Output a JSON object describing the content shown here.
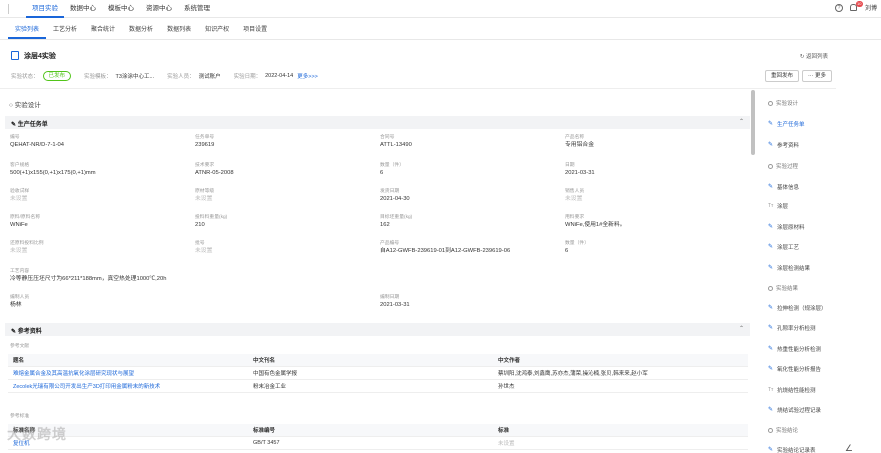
{
  "topnav": {
    "items": [
      "项目实验",
      "数据中心",
      "模板中心",
      "资源中心",
      "系统管理"
    ],
    "active_index": 0,
    "help_glyph": "?",
    "notification_count": "10",
    "user_name": "刘博"
  },
  "subtabs": {
    "items": [
      "实验列表",
      "工艺分析",
      "聚合统计",
      "数据分析",
      "数据列表",
      "知识产权",
      "项目设置"
    ],
    "active_index": 0
  },
  "header": {
    "title": "涂层4实验",
    "back_label": "返回列表",
    "status_label": "实验状态：",
    "status_value": "已发布",
    "template_label": "实验模板：",
    "template_value": "T3涂涂中心工...",
    "person_label": "实验人员：",
    "person_value": "测试账户",
    "date_label": "实验日期：",
    "date_value": "2022-04-14",
    "more_label": "更多>>>",
    "republish_label": "重回发布",
    "more_btn_label": "··· 更多"
  },
  "main": {
    "design_label": "实验设计",
    "task_section": "生产任务单",
    "fields": [
      {
        "k": "编号",
        "v": "QEHAT-NR/D-7-1-04"
      },
      {
        "k": "任务单号",
        "v": "239619"
      },
      {
        "k": "合同号",
        "v": "ATTL-13490"
      },
      {
        "k": "产品名称",
        "v": "专用铝合金"
      },
      {
        "k": "客户规格",
        "v": "500(+1)x155(0,+1)x175(0,+1)mm"
      },
      {
        "k": "技术要求",
        "v": "ATNR-05-2008"
      },
      {
        "k": "数量（件）",
        "v": "6"
      },
      {
        "k": "日期",
        "v": "2021-03-31"
      },
      {
        "k": "验收试样",
        "v": "未设置"
      },
      {
        "k": "原材等级",
        "v": "未设置"
      },
      {
        "k": "发货日期",
        "v": "2021-04-30"
      },
      {
        "k": "销售人员",
        "v": "未设置"
      },
      {
        "k": "原料/原料名称",
        "v": "WNiFe"
      },
      {
        "k": "投料料重量(kg)",
        "v": "210"
      },
      {
        "k": "目标坯重量(kg)",
        "v": "162"
      },
      {
        "k": "用料要求",
        "v": "WNiFe,使用1#全新料。"
      },
      {
        "k": "还原料投料比例",
        "v": "未设置"
      },
      {
        "k": "批号",
        "v": "未设置"
      },
      {
        "k": "产品编号",
        "v": "自A12-GWFB-239619-01到A12-GWFB-239619-06"
      },
      {
        "k": "数量（件）",
        "v": "6"
      },
      {
        "k": "工艺内容",
        "v": "冷等静压压坯尺寸为66*211*188mm，真空热处理1000℃,20h"
      },
      {
        "k": "编制人员",
        "v": "杨林"
      },
      {
        "k": "编制日期",
        "v": "2021-03-31"
      }
    ],
    "ref_section": "参考资料",
    "lit_label": "参考文献",
    "lit_headers": [
      "题名",
      "中文刊名",
      "中文作者"
    ],
    "lit_rows": [
      [
        "难熔金属合金及其高温抗氧化涂层研究现状与展望",
        "中国有色金属学报",
        "蔡圳阳,沈鸿泰,刘鑫鹰,苏亦杰,蒲荣,操沁楠,张贝,韩来来,赵小军"
      ],
      [
        "Zecolek光瑞有限公司开发出生产3D打印用金属粉末的新技术",
        "粉末冶金工业",
        "孙世杰"
      ]
    ],
    "std_label": "参考标准",
    "std_headers": [
      "标准名称",
      "标准编号",
      "标准"
    ],
    "std_rows": [
      [
        "复位机",
        "GB/T 3457",
        "未设置"
      ]
    ]
  },
  "sidebar": {
    "items": [
      {
        "label": "实验设计",
        "kind": "dot"
      },
      {
        "label": "生产任务单",
        "kind": "pen",
        "active": true
      },
      {
        "label": "参考资料",
        "kind": "pen"
      },
      {
        "label": "实验过程",
        "kind": "dot"
      },
      {
        "label": "基体信息",
        "kind": "pen"
      },
      {
        "label": "涂层",
        "kind": "tx"
      },
      {
        "label": "涂层原材料",
        "kind": "pen"
      },
      {
        "label": "涂层工艺",
        "kind": "pen"
      },
      {
        "label": "涂层检测结果",
        "kind": "pen"
      },
      {
        "label": "实验结果",
        "kind": "dot"
      },
      {
        "label": "拉伸检测（规涂层）",
        "kind": "pen"
      },
      {
        "label": "孔隙率分析检测",
        "kind": "pen"
      },
      {
        "label": "热重性能分析检测",
        "kind": "pen"
      },
      {
        "label": "氧化性能分析报告",
        "kind": "pen"
      },
      {
        "label": "抗烧结性能检测",
        "kind": "tx"
      },
      {
        "label": "烧结试验过程记录",
        "kind": "pen"
      },
      {
        "label": "实验结论",
        "kind": "dot"
      },
      {
        "label": "实验结论记录表",
        "kind": "pen"
      }
    ]
  },
  "watermark": "大数跨境"
}
